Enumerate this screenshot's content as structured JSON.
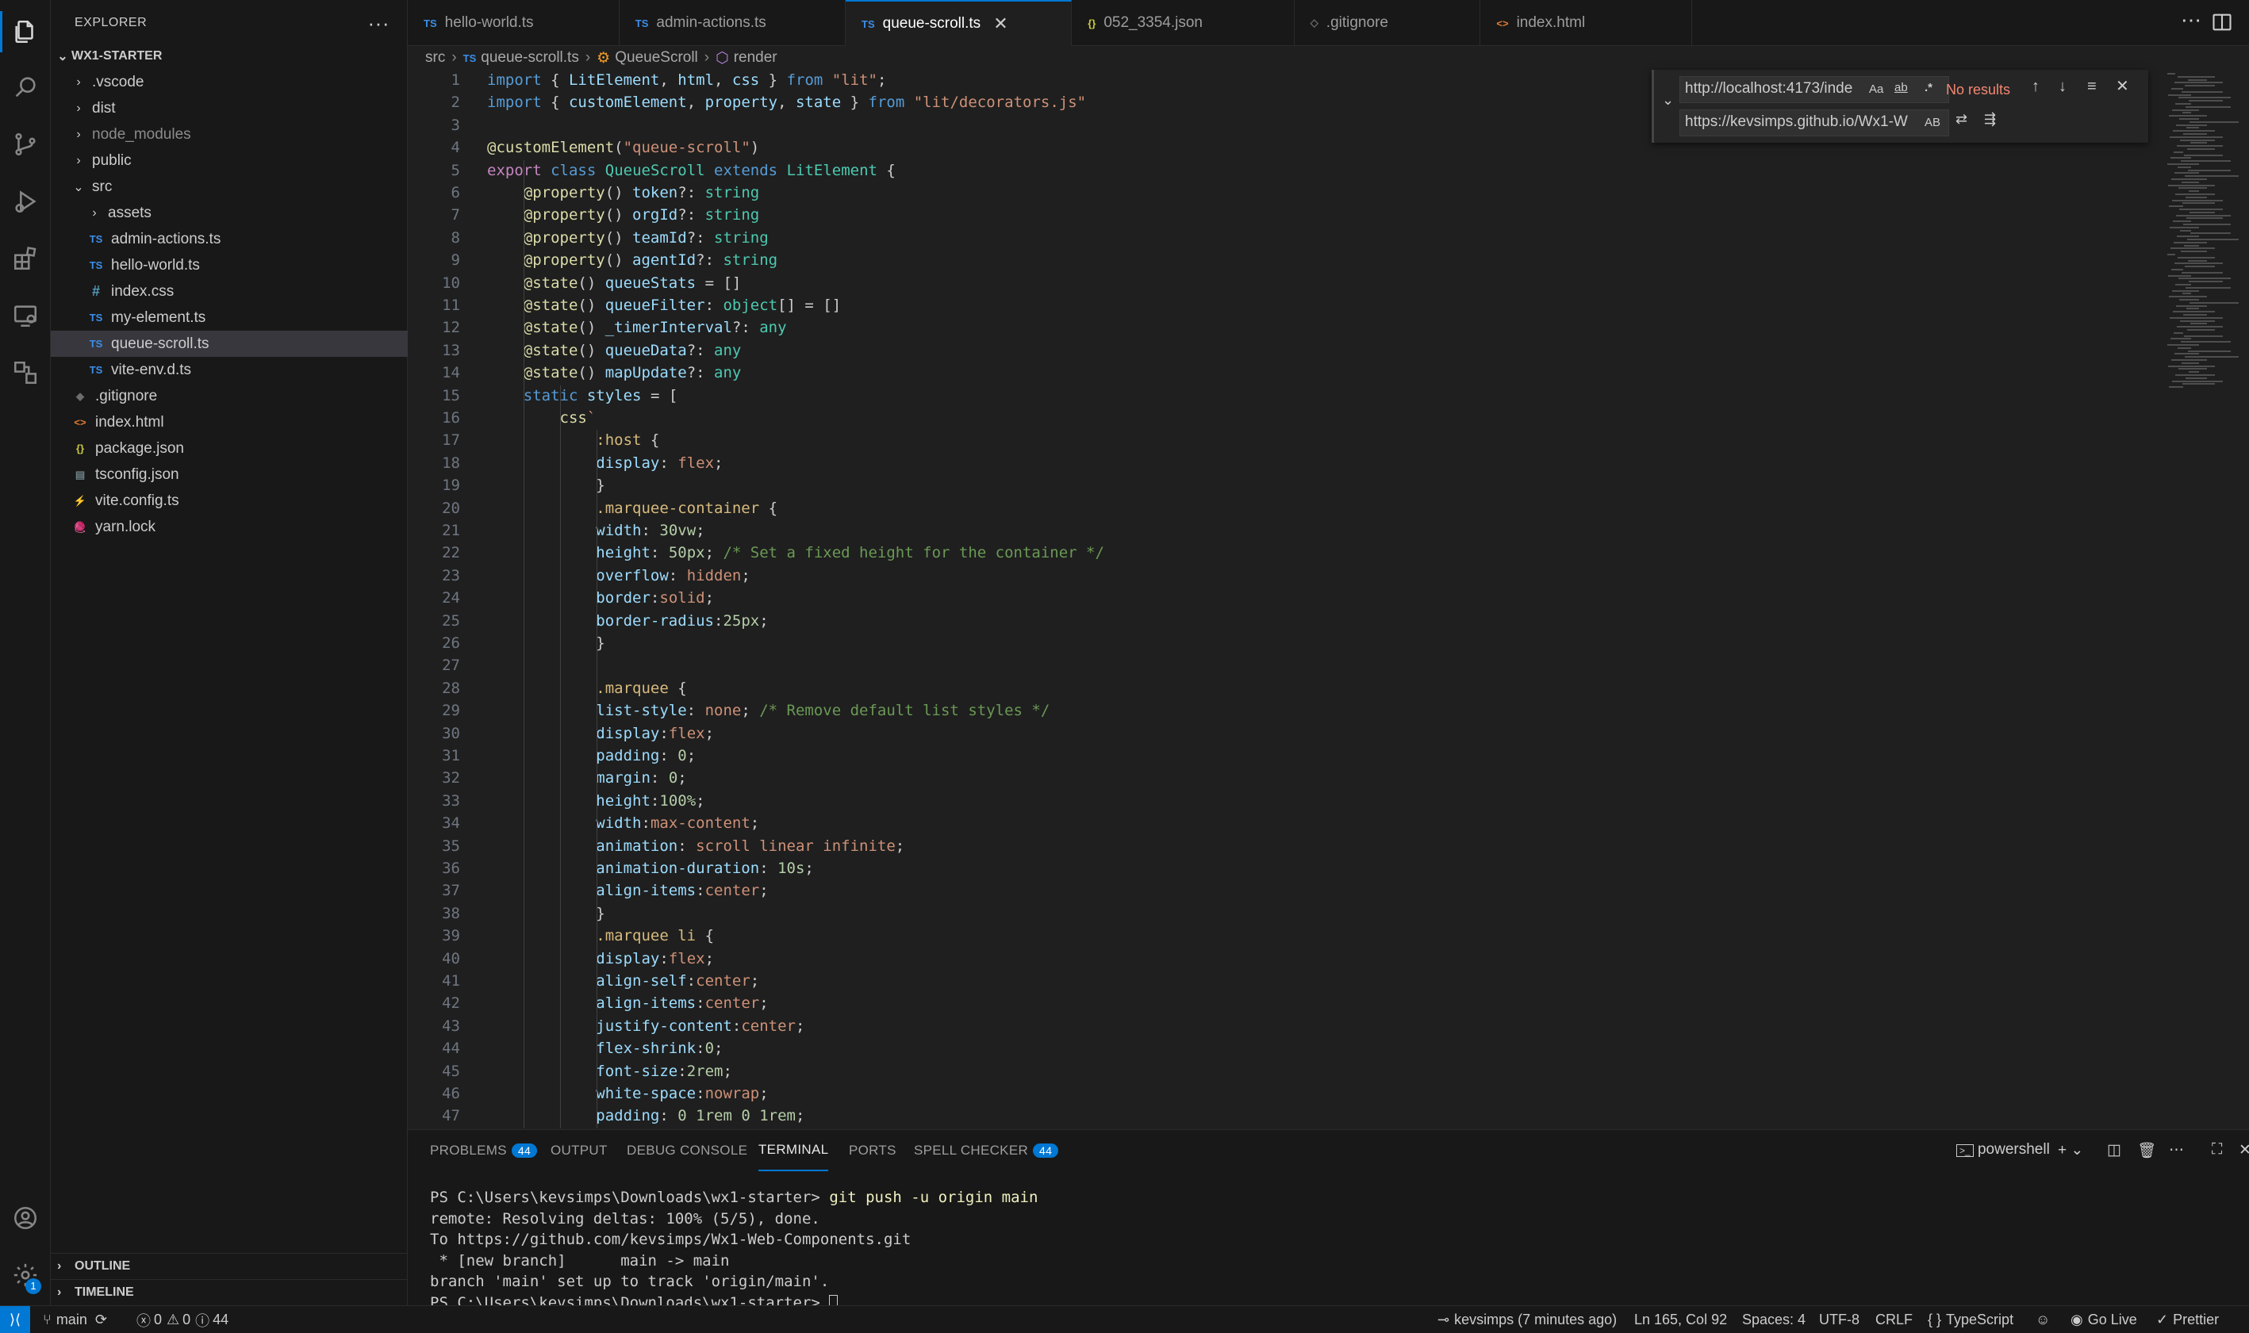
{
  "explorer": {
    "title": "EXPLORER",
    "more": "···",
    "root": "WX1-STARTER",
    "items": [
      {
        "label": ".vscode",
        "kind": "folder",
        "depth": 1,
        "collapsed": true
      },
      {
        "label": "dist",
        "kind": "folder",
        "depth": 1,
        "collapsed": true
      },
      {
        "label": "node_modules",
        "kind": "folder",
        "depth": 1,
        "collapsed": true
      },
      {
        "label": "public",
        "kind": "folder",
        "depth": 1,
        "collapsed": true
      },
      {
        "label": "src",
        "kind": "folder",
        "depth": 1,
        "collapsed": false
      },
      {
        "label": "assets",
        "kind": "folder",
        "depth": 2,
        "collapsed": true
      },
      {
        "label": "admin-actions.ts",
        "kind": "ts",
        "depth": 2
      },
      {
        "label": "hello-world.ts",
        "kind": "ts",
        "depth": 2
      },
      {
        "label": "index.css",
        "kind": "css",
        "depth": 2
      },
      {
        "label": "my-element.ts",
        "kind": "ts",
        "depth": 2
      },
      {
        "label": "queue-scroll.ts",
        "kind": "ts",
        "depth": 2,
        "selected": true
      },
      {
        "label": "vite-env.d.ts",
        "kind": "ts",
        "depth": 2
      },
      {
        "label": ".gitignore",
        "kind": "git",
        "depth": 1
      },
      {
        "label": "index.html",
        "kind": "html",
        "depth": 1
      },
      {
        "label": "package.json",
        "kind": "json",
        "depth": 1
      },
      {
        "label": "tsconfig.json",
        "kind": "cfg",
        "depth": 1
      },
      {
        "label": "vite.config.ts",
        "kind": "vite",
        "depth": 1
      },
      {
        "label": "yarn.lock",
        "kind": "yarn",
        "depth": 1
      }
    ],
    "outline": "OUTLINE",
    "timeline": "TIMELINE"
  },
  "tabs": [
    {
      "icon": "TS",
      "label": "hello-world.ts"
    },
    {
      "icon": "TS",
      "label": "admin-actions.ts"
    },
    {
      "icon": "TS",
      "label": "queue-scroll.ts",
      "active": true
    },
    {
      "icon": "{}",
      "label": "052_3354.json"
    },
    {
      "icon": "◇",
      "label": ".gitignore"
    },
    {
      "icon": "<>",
      "label": "index.html"
    }
  ],
  "breadcrumb": [
    "src",
    "queue-scroll.ts",
    "QueueScroll",
    "render"
  ],
  "find": {
    "find_value": "http://localhost:4173/inde",
    "replace_value": "https://kevsimps.github.io/Wx1-W",
    "status": "No results",
    "opt_case": "Aa",
    "opt_word": "ab",
    "opt_regex": ".*",
    "opt_preserve": "AB"
  },
  "code": [
    [
      [
        "k",
        "import"
      ],
      [
        "",
        " { "
      ],
      [
        "v",
        "LitElement"
      ],
      [
        "",
        ", "
      ],
      [
        "v",
        "html"
      ],
      [
        "",
        ", "
      ],
      [
        "v",
        "css"
      ],
      [
        "",
        " } "
      ],
      [
        "k",
        "from"
      ],
      [
        "",
        " "
      ],
      [
        "s",
        "\"lit\""
      ],
      [
        "",
        ";"
      ]
    ],
    [
      [
        "k",
        "import"
      ],
      [
        "",
        " { "
      ],
      [
        "v",
        "customElement"
      ],
      [
        "",
        ", "
      ],
      [
        "v",
        "property"
      ],
      [
        "",
        ", "
      ],
      [
        "v",
        "state"
      ],
      [
        "",
        " } "
      ],
      [
        "k",
        "from"
      ],
      [
        "",
        " "
      ],
      [
        "s",
        "\"lit/decorators.js\""
      ]
    ],
    [],
    [
      [
        "f",
        "@customElement"
      ],
      [
        "",
        "("
      ],
      [
        "s",
        "\"queue-scroll\""
      ],
      [
        "",
        ")"
      ]
    ],
    [
      [
        "kc",
        "export"
      ],
      [
        "",
        " "
      ],
      [
        "k",
        "class"
      ],
      [
        "",
        " "
      ],
      [
        "t",
        "QueueScroll"
      ],
      [
        "",
        " "
      ],
      [
        "k",
        "extends"
      ],
      [
        "",
        " "
      ],
      [
        "t",
        "LitElement"
      ],
      [
        "",
        " {"
      ]
    ],
    [
      [
        "",
        "    "
      ],
      [
        "f",
        "@property"
      ],
      [
        "",
        "() "
      ],
      [
        "v",
        "token"
      ],
      [
        "",
        "?: "
      ],
      [
        "t",
        "string"
      ]
    ],
    [
      [
        "",
        "    "
      ],
      [
        "f",
        "@property"
      ],
      [
        "",
        "() "
      ],
      [
        "v",
        "orgId"
      ],
      [
        "",
        "?: "
      ],
      [
        "t",
        "string"
      ]
    ],
    [
      [
        "",
        "    "
      ],
      [
        "f",
        "@property"
      ],
      [
        "",
        "() "
      ],
      [
        "v",
        "teamId"
      ],
      [
        "",
        "?: "
      ],
      [
        "t",
        "string"
      ]
    ],
    [
      [
        "",
        "    "
      ],
      [
        "f",
        "@property"
      ],
      [
        "",
        "() "
      ],
      [
        "v",
        "agentId"
      ],
      [
        "",
        "?: "
      ],
      [
        "t",
        "string"
      ]
    ],
    [
      [
        "",
        "    "
      ],
      [
        "f",
        "@state"
      ],
      [
        "",
        "() "
      ],
      [
        "v",
        "queueStats"
      ],
      [
        "",
        " = []"
      ]
    ],
    [
      [
        "",
        "    "
      ],
      [
        "f",
        "@state"
      ],
      [
        "",
        "() "
      ],
      [
        "v",
        "queueFilter"
      ],
      [
        "",
        ": "
      ],
      [
        "t",
        "object"
      ],
      [
        "",
        "[] = []"
      ]
    ],
    [
      [
        "",
        "    "
      ],
      [
        "f",
        "@state"
      ],
      [
        "",
        "() "
      ],
      [
        "v",
        "_timerInterval"
      ],
      [
        "",
        "?: "
      ],
      [
        "t",
        "any"
      ]
    ],
    [
      [
        "",
        "    "
      ],
      [
        "f",
        "@state"
      ],
      [
        "",
        "() "
      ],
      [
        "v",
        "queueData"
      ],
      [
        "",
        "?: "
      ],
      [
        "t",
        "any"
      ]
    ],
    [
      [
        "",
        "    "
      ],
      [
        "f",
        "@state"
      ],
      [
        "",
        "() "
      ],
      [
        "v",
        "mapUpdate"
      ],
      [
        "",
        "?: "
      ],
      [
        "t",
        "any"
      ]
    ],
    [
      [
        "",
        "    "
      ],
      [
        "k",
        "static"
      ],
      [
        "",
        " "
      ],
      [
        "v",
        "styles"
      ],
      [
        "",
        " = ["
      ]
    ],
    [
      [
        "",
        "        "
      ],
      [
        "f",
        "css"
      ],
      [
        "s",
        "`"
      ]
    ],
    [
      [
        "",
        "            "
      ],
      [
        "p",
        ":host"
      ],
      [
        "",
        " {"
      ]
    ],
    [
      [
        "",
        "            "
      ],
      [
        "v",
        "display"
      ],
      [
        "",
        ": "
      ],
      [
        "s",
        "flex"
      ],
      [
        "",
        ";"
      ]
    ],
    [
      [
        "",
        "            }"
      ]
    ],
    [
      [
        "",
        "            "
      ],
      [
        "p",
        ".marquee-container"
      ],
      [
        "",
        " {"
      ]
    ],
    [
      [
        "",
        "            "
      ],
      [
        "v",
        "width"
      ],
      [
        "",
        ": "
      ],
      [
        "n",
        "30vw"
      ],
      [
        "",
        ";"
      ]
    ],
    [
      [
        "",
        "            "
      ],
      [
        "v",
        "height"
      ],
      [
        "",
        ": "
      ],
      [
        "n",
        "50px"
      ],
      [
        "",
        "; "
      ],
      [
        "c",
        "/* Set a fixed height for the container */"
      ]
    ],
    [
      [
        "",
        "            "
      ],
      [
        "v",
        "overflow"
      ],
      [
        "",
        ": "
      ],
      [
        "s",
        "hidden"
      ],
      [
        "",
        ";"
      ]
    ],
    [
      [
        "",
        "            "
      ],
      [
        "v",
        "border"
      ],
      [
        "",
        ":"
      ],
      [
        "s",
        "solid"
      ],
      [
        "",
        ";"
      ]
    ],
    [
      [
        "",
        "            "
      ],
      [
        "v",
        "border-radius"
      ],
      [
        "",
        ":"
      ],
      [
        "n",
        "25px"
      ],
      [
        "",
        ";"
      ]
    ],
    [
      [
        "",
        "            }"
      ]
    ],
    [],
    [
      [
        "",
        "            "
      ],
      [
        "p",
        ".marquee"
      ],
      [
        "",
        " {"
      ]
    ],
    [
      [
        "",
        "            "
      ],
      [
        "v",
        "list-style"
      ],
      [
        "",
        ": "
      ],
      [
        "s",
        "none"
      ],
      [
        "",
        "; "
      ],
      [
        "c",
        "/* Remove default list styles */"
      ]
    ],
    [
      [
        "",
        "            "
      ],
      [
        "v",
        "display"
      ],
      [
        "",
        ":"
      ],
      [
        "s",
        "flex"
      ],
      [
        "",
        ";"
      ]
    ],
    [
      [
        "",
        "            "
      ],
      [
        "v",
        "padding"
      ],
      [
        "",
        ": "
      ],
      [
        "n",
        "0"
      ],
      [
        "",
        ";"
      ]
    ],
    [
      [
        "",
        "            "
      ],
      [
        "v",
        "margin"
      ],
      [
        "",
        ": "
      ],
      [
        "n",
        "0"
      ],
      [
        "",
        ";"
      ]
    ],
    [
      [
        "",
        "            "
      ],
      [
        "v",
        "height"
      ],
      [
        "",
        ":"
      ],
      [
        "n",
        "100%"
      ],
      [
        "",
        ";"
      ]
    ],
    [
      [
        "",
        "            "
      ],
      [
        "v",
        "width"
      ],
      [
        "",
        ":"
      ],
      [
        "s",
        "max-content"
      ],
      [
        "",
        ";"
      ]
    ],
    [
      [
        "",
        "            "
      ],
      [
        "v",
        "animation"
      ],
      [
        "",
        ": "
      ],
      [
        "s",
        "scroll linear infinite"
      ],
      [
        "",
        ";"
      ]
    ],
    [
      [
        "",
        "            "
      ],
      [
        "v",
        "animation-duration"
      ],
      [
        "",
        ": "
      ],
      [
        "n",
        "10s"
      ],
      [
        "",
        ";"
      ]
    ],
    [
      [
        "",
        "            "
      ],
      [
        "v",
        "align-items"
      ],
      [
        "",
        ":"
      ],
      [
        "s",
        "center"
      ],
      [
        "",
        ";"
      ]
    ],
    [
      [
        "",
        "            }"
      ]
    ],
    [
      [
        "",
        "            "
      ],
      [
        "p",
        ".marquee li"
      ],
      [
        "",
        " {"
      ]
    ],
    [
      [
        "",
        "            "
      ],
      [
        "v",
        "display"
      ],
      [
        "",
        ":"
      ],
      [
        "s",
        "flex"
      ],
      [
        "",
        ";"
      ]
    ],
    [
      [
        "",
        "            "
      ],
      [
        "v",
        "align-self"
      ],
      [
        "",
        ":"
      ],
      [
        "s",
        "center"
      ],
      [
        "",
        ";"
      ]
    ],
    [
      [
        "",
        "            "
      ],
      [
        "v",
        "align-items"
      ],
      [
        "",
        ":"
      ],
      [
        "s",
        "center"
      ],
      [
        "",
        ";"
      ]
    ],
    [
      [
        "",
        "            "
      ],
      [
        "v",
        "justify-content"
      ],
      [
        "",
        ":"
      ],
      [
        "s",
        "center"
      ],
      [
        "",
        ";"
      ]
    ],
    [
      [
        "",
        "            "
      ],
      [
        "v",
        "flex-shrink"
      ],
      [
        "",
        ":"
      ],
      [
        "n",
        "0"
      ],
      [
        "",
        ";"
      ]
    ],
    [
      [
        "",
        "            "
      ],
      [
        "v",
        "font-size"
      ],
      [
        "",
        ":"
      ],
      [
        "n",
        "2rem"
      ],
      [
        "",
        ";"
      ]
    ],
    [
      [
        "",
        "            "
      ],
      [
        "v",
        "white-space"
      ],
      [
        "",
        ":"
      ],
      [
        "s",
        "nowrap"
      ],
      [
        "",
        ";"
      ]
    ],
    [
      [
        "",
        "            "
      ],
      [
        "v",
        "padding"
      ],
      [
        "",
        ": "
      ],
      [
        "n",
        "0 1rem 0 1rem"
      ],
      [
        "",
        ";"
      ]
    ]
  ],
  "panel": {
    "tabs": [
      {
        "label": "PROBLEMS",
        "badge": "44"
      },
      {
        "label": "OUTPUT"
      },
      {
        "label": "DEBUG CONSOLE"
      },
      {
        "label": "TERMINAL",
        "active": true
      },
      {
        "label": "PORTS"
      },
      {
        "label": "SPELL CHECKER",
        "badge": "44"
      }
    ],
    "shell": "powershell",
    "terminal": [
      {
        "prompt": "PS C:\\Users\\kevsimps\\Downloads\\wx1-starter> ",
        "cmd": "git push -u origin main"
      },
      {
        "text": "remote: Resolving deltas: 100% (5/5), done."
      },
      {
        "text": "To https://github.com/kevsimps/Wx1-Web-Components.git"
      },
      {
        "text": " * [new branch]      main -> main"
      },
      {
        "text": "branch 'main' set up to track 'origin/main'."
      },
      {
        "prompt": "PS C:\\Users\\kevsimps\\Downloads\\wx1-starter> ",
        "cursor": true
      }
    ]
  },
  "status": {
    "branch": "main",
    "errors": "0",
    "warnings": "0",
    "info": "44",
    "blame": "kevsimps (7 minutes ago)",
    "position": "Ln 165, Col 92",
    "spaces": "Spaces: 4",
    "encoding": "UTF-8",
    "eol": "CRLF",
    "language": "TypeScript",
    "golive": "Go Live",
    "prettier": "Prettier"
  },
  "activity_badge": "1"
}
